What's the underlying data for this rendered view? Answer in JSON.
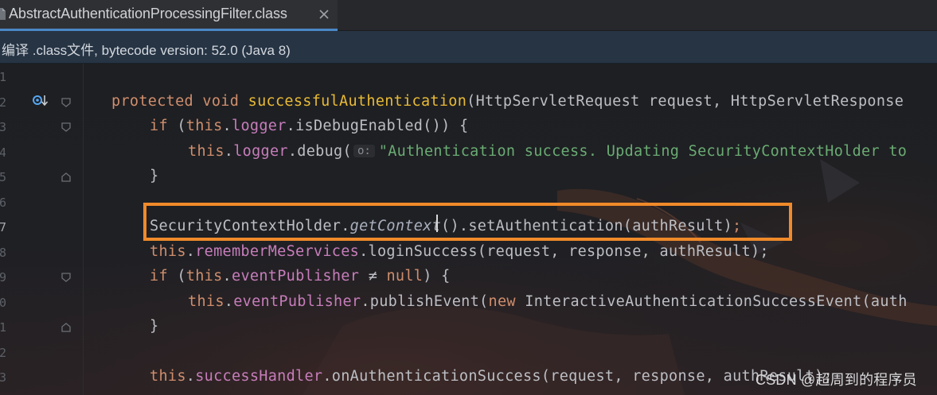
{
  "tab": {
    "title": "AbstractAuthenticationProcessingFilter.class",
    "file_icon": "java-class-file-icon",
    "close_icon": "close-icon"
  },
  "banner": {
    "text": "编译 .class文件, bytecode version: 52.0 (Java 8)"
  },
  "gutter": {
    "line_numbers": [
      "1",
      "2",
      "3",
      "4",
      "5",
      "6",
      "7",
      "8",
      "9",
      "0",
      "1",
      "2",
      "3"
    ],
    "override_icon": "override-method-icon"
  },
  "code": {
    "l2": {
      "kw1": "protected",
      "kw2": "void",
      "method": "successfulAuthentication",
      "rest": "(HttpServletRequest request, HttpServletResponse"
    },
    "l3": {
      "kw": "if",
      "p1": " (",
      "this": "this",
      "dot": ".",
      "field": "logger",
      "rest": ".isDebugEnabled()) {"
    },
    "l4": {
      "this": "this",
      "dot": ".",
      "field": "logger",
      "call": ".debug(",
      "hint": "o:",
      "str": "\"Authentication success. Updating SecurityContextHolder to"
    },
    "l5": {
      "text": "}"
    },
    "l7": {
      "p1": "SecurityContextHolder.",
      "italic": "getContext",
      "p2": "().setAuthentication(authResult)",
      "semi": ";"
    },
    "l8": {
      "this": "this",
      "dot": ".",
      "field": "rememberMeServices",
      "rest": ".loginSuccess(request, response, authResult);"
    },
    "l9": {
      "kw": "if",
      "p1": " (",
      "this": "this",
      "dot": ".",
      "field": "eventPublisher",
      "op": " ≠ ",
      "null": "null",
      "rest": ") {"
    },
    "l10": {
      "this": "this",
      "dot": ".",
      "field": "eventPublisher",
      "call": ".publishEvent(",
      "new": "new",
      "rest": " InteractiveAuthenticationSuccessEvent(auth"
    },
    "l11": {
      "text": "}"
    },
    "l13": {
      "this": "this",
      "dot": ".",
      "field": "successHandler",
      "rest": ".onAuthenticationSuccess(request, response, authResult);"
    }
  },
  "watermark": "CSDN @超周到的程序员",
  "colors": {
    "highlight_border": "#f08a2a",
    "keyword": "#cf8e6d",
    "method": "#e8ba36",
    "field": "#c77dbb",
    "string": "#6aab73",
    "tab_underline": "#4a88c7"
  }
}
